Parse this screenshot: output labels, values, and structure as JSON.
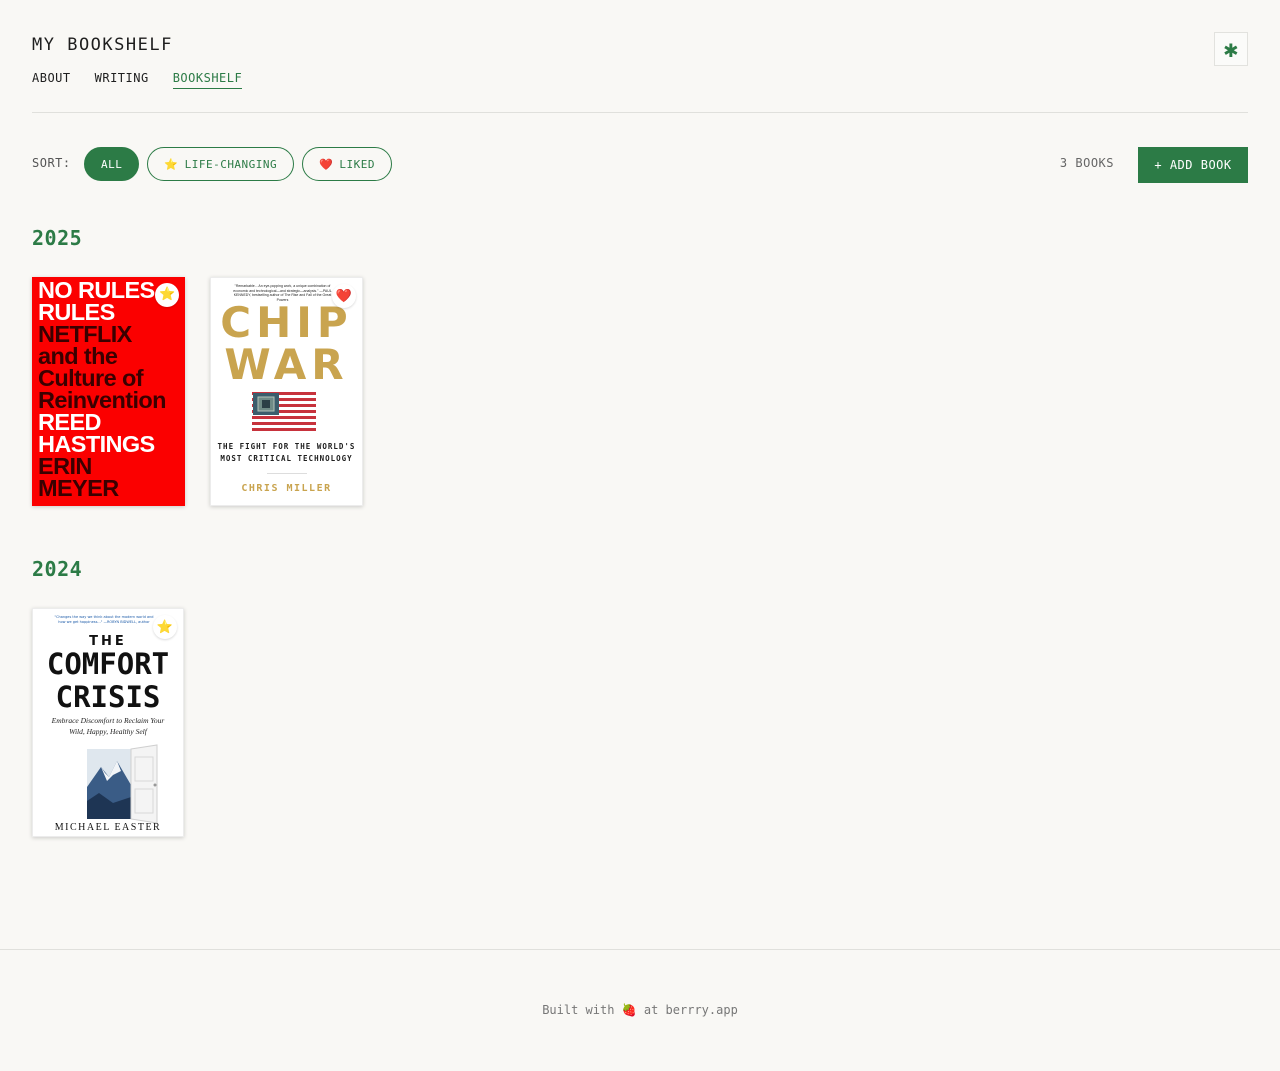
{
  "site": {
    "title": "MY BOOKSHELF"
  },
  "nav": {
    "items": [
      {
        "label": "ABOUT"
      },
      {
        "label": "WRITING"
      },
      {
        "label": "BOOKSHELF"
      }
    ]
  },
  "theme_toggle": {
    "glyph": "✱"
  },
  "toolbar": {
    "sort_label": "SORT:",
    "filters": [
      {
        "icon": "",
        "label": "ALL"
      },
      {
        "icon": "⭐",
        "label": "LIFE-CHANGING"
      },
      {
        "icon": "❤️",
        "label": "LIKED"
      }
    ],
    "count": "3 BOOKS",
    "add_label": "+ ADD BOOK"
  },
  "years": [
    {
      "year": "2025"
    },
    {
      "year": "2024"
    }
  ],
  "books": {
    "no_rules": {
      "badge": "⭐",
      "cover_title": [
        "NO RULES",
        "RULES",
        "NETFLIX",
        "and the",
        "Culture of",
        "Reinvention"
      ],
      "cover_authors": [
        "REED",
        "HASTINGS",
        "ERIN",
        "MEYER"
      ]
    },
    "chip_war": {
      "badge": "❤️",
      "blurb": "\"Remarkable... An eye-popping work, a unique combination of economic and technological—and strategic—analysis.\" —PAUL KENNEDY, bestselling author of The Rise and Fall of the Great Powers",
      "title_lines": [
        "CHIP",
        "WAR"
      ],
      "subtitle_lines": [
        "THE FIGHT FOR THE WORLD'S",
        "MOST CRITICAL TECHNOLOGY"
      ],
      "author": "CHRIS MILLER"
    },
    "comfort_crisis": {
      "badge": "⭐",
      "blurb": "\"Changes the way we think about the modern world and how we get happiness...\" —ROBYN BIDWELL, author",
      "the": "THE",
      "title_lines": [
        "COMFORT",
        "CRISIS"
      ],
      "subtitle_lines": [
        "Embrace Discomfort to Reclaim Your",
        "Wild, Happy, Healthy Self"
      ],
      "author": "MICHAEL EASTER"
    }
  },
  "footer": {
    "prefix": "Built with ",
    "emoji": "🍓",
    "middle": " at ",
    "link": "berrry.app"
  },
  "colors": {
    "accent": "#2c7b46",
    "background": "#f9f8f5",
    "cover_red": "#fb0000",
    "chip_gold": "#c9a44f"
  }
}
